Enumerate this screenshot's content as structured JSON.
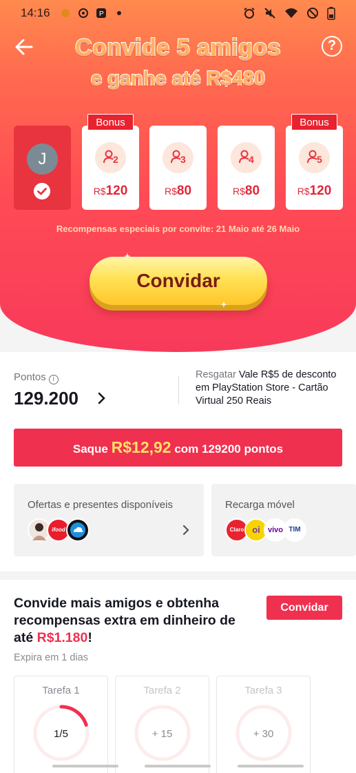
{
  "status_bar": {
    "time": "14:16"
  },
  "hero": {
    "title_line1": "Convide 5 amigos",
    "title_line2": "e ganhe até R$480",
    "me_avatar_letter": "J",
    "cards": [
      {
        "friend_number": "2",
        "currency": "R$",
        "amount": "120",
        "bonus_label": "Bonus"
      },
      {
        "friend_number": "3",
        "currency": "R$",
        "amount": "80",
        "bonus_label": ""
      },
      {
        "friend_number": "4",
        "currency": "R$",
        "amount": "80",
        "bonus_label": ""
      },
      {
        "friend_number": "5",
        "currency": "R$",
        "amount": "120",
        "bonus_label": "Bonus"
      }
    ],
    "promo_note": "Recompensas especiais por convite: 21 Maio até 26 Maio",
    "invite_button": "Convidar"
  },
  "points": {
    "label": "Pontos",
    "value": "129.200",
    "redeem_prefix": "Resgatar",
    "redeem_item": "Vale R$5 de desconto em PlayStation Store - Cartão Virtual 250 Reais",
    "cash_prefix": "Saque",
    "cash_amount": "R$12,92",
    "cash_suffix": "com 129200 pontos",
    "offers_title": "Ofertas e presentes disponíveis",
    "recharge_title": "Recarga móvel",
    "offer_logos": [
      "person-logo",
      "ifood-logo",
      "cloud-logo"
    ],
    "recharge_logos": [
      {
        "name": "claro-logo",
        "text": "Claro"
      },
      {
        "name": "oi-logo",
        "text": "oi"
      },
      {
        "name": "vivo-logo",
        "text": "vivo"
      },
      {
        "name": "tim-logo",
        "text": "TIM"
      }
    ]
  },
  "more": {
    "title_prefix": "Convide mais amigos e obtenha recompensas extra em dinheiro de até",
    "title_amount": "R$1.180",
    "title_suffix": "!",
    "invite_button": "Convidar",
    "expires": "Expira em 1 dias",
    "tasks": [
      {
        "name": "Tarefa 1",
        "progress_label": "1/5",
        "progress": 0.2
      },
      {
        "name": "Tarefa 2",
        "progress_label": "+ 15",
        "progress": 0
      },
      {
        "name": "Tarefa 3",
        "progress_label": "+ 30",
        "progress": 0
      }
    ]
  },
  "colors": {
    "primary": "#f0304f",
    "hero_top": "#ff8a4e",
    "hero_bottom": "#f83a5a",
    "gold": "#ffd23f"
  }
}
